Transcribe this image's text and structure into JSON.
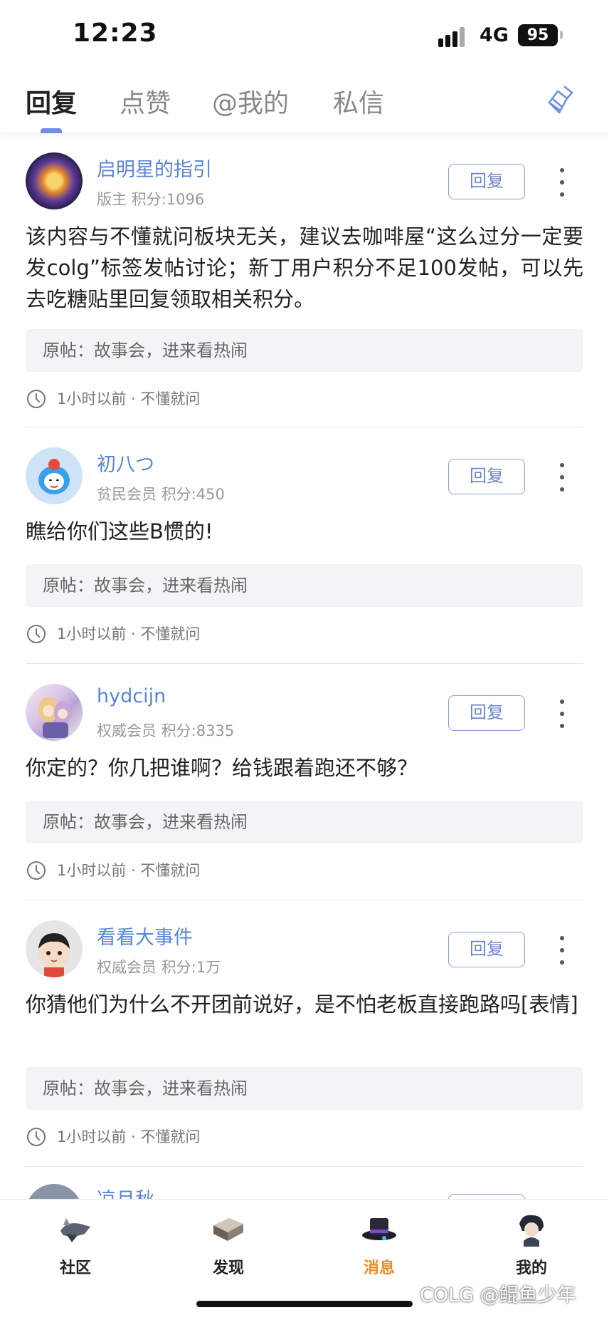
{
  "status_bar": {
    "time": "12:23",
    "network": "4G",
    "battery": "95"
  },
  "tabs": [
    {
      "label": "回复",
      "active": true
    },
    {
      "label": "点赞",
      "active": false
    },
    {
      "label": "@我的",
      "active": false
    },
    {
      "label": "私信",
      "active": false
    }
  ],
  "clear_icon": "broom-icon",
  "reply_label": "回复",
  "posts": [
    {
      "username": "启明星的指引",
      "rank": "版主",
      "points": "积分:1096",
      "content": "该内容与不懂就问板块无关，建议去咖啡屋“这么过分一定要发colg”标签发帖讨论；新丁用户积分不足100发帖，可以先去吃糖贴里回复领取相关积分。",
      "origin": "原帖：故事会，进来看热闹",
      "time": "1小时以前",
      "board": "不懂就问"
    },
    {
      "username": "初八つ",
      "rank": "贫民会员",
      "points": "积分:450",
      "content": "瞧给你们这些B惯的!",
      "origin": "原帖：故事会，进来看热闹",
      "time": "1小时以前",
      "board": "不懂就问"
    },
    {
      "username": "hydcijn",
      "rank": "权威会员",
      "points": "积分:8335",
      "content": "你定的？你几把谁啊？给钱跟着跑还不够？",
      "origin": "原帖：故事会，进来看热闹",
      "time": "1小时以前",
      "board": "不懂就问"
    },
    {
      "username": "看看大事件",
      "rank": "权威会员",
      "points": "积分:1万",
      "content": "你猜他们为什么不开团前说好，是不怕老板直接跑路吗[表情]",
      "origin": "原帖：故事会，进来看热闹",
      "time": "1小时以前",
      "board": "不懂就问"
    }
  ],
  "partial_next_username": "凉月秋",
  "bottom_nav": [
    {
      "label": "社区",
      "icon": "airship-icon",
      "active": false
    },
    {
      "label": "发现",
      "icon": "book-icon",
      "active": false
    },
    {
      "label": "消息",
      "icon": "top-hat-icon",
      "active": true
    },
    {
      "label": "我的",
      "icon": "character-avatar-icon",
      "active": false
    }
  ],
  "watermark": "COLG @鲲鱼少年",
  "colors": {
    "accent": "#5a86d6",
    "active_nav": "#f08a1c"
  }
}
